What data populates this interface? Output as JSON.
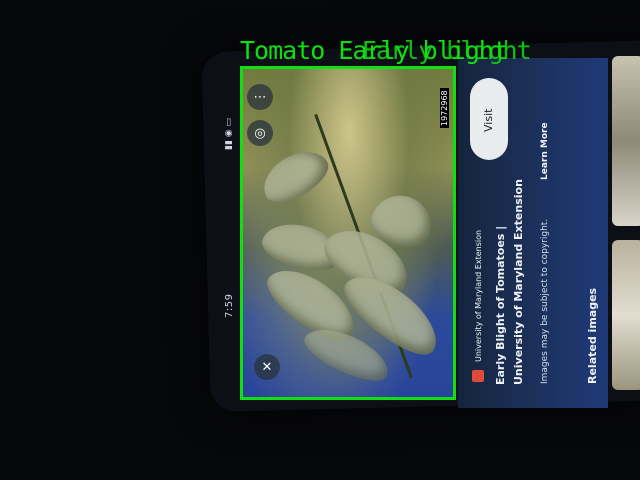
{
  "detection": {
    "label": "Tomato  Early blight",
    "label_overlap": "Early blight",
    "box_color": "#10e010"
  },
  "status_bar": {
    "time": "7:59",
    "icons": "signal-icon wifi-icon battery-icon"
  },
  "image_viewer": {
    "photo_subject": "tomato leaves",
    "more_icon": "more-icon",
    "lens_icon": "lens-icon",
    "close_icon": "close-icon",
    "counter": "1972968"
  },
  "info_panel": {
    "visit_label": "Visit",
    "source_name": "University of Maryland Extension",
    "title_line1": "Early Blight of Tomatoes |",
    "title_line2": "University of Maryland Extension",
    "copyright_text": "Images may be subject to copyright.",
    "learn_more": "Learn More",
    "related_heading": "Related images"
  },
  "colors": {
    "panel_blue": "#1f3a78",
    "detection_green": "#10e010"
  }
}
